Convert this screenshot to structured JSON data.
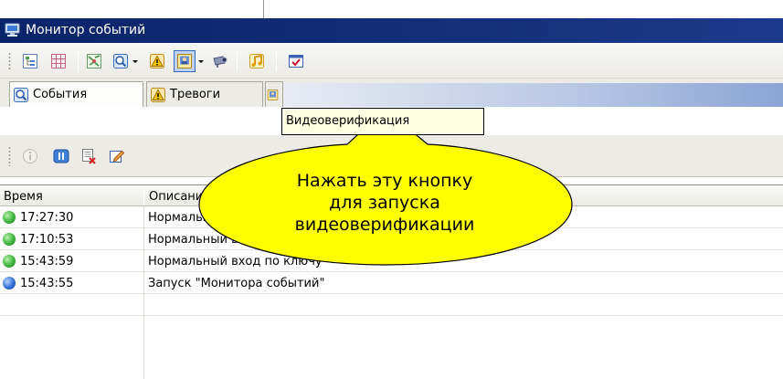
{
  "window": {
    "title": "Монитор событий",
    "title_icon": "monitor-icon"
  },
  "toolbar": {
    "buttons": [
      {
        "icon": "tree-view-icon"
      },
      {
        "icon": "grid-view-icon"
      },
      {
        "icon": "map-view-icon"
      },
      {
        "icon": "events-icon"
      },
      {
        "icon": "alarm-icon"
      },
      {
        "icon": "video-verification-icon",
        "pressed": true
      },
      {
        "icon": "camera-icon"
      },
      {
        "icon": "music-note-icon"
      },
      {
        "icon": "checked-window-icon"
      }
    ]
  },
  "tabs": [
    {
      "label": "События",
      "icon": "events-icon"
    },
    {
      "label": "Тревоги",
      "icon": "alarm-icon"
    },
    {
      "label": "",
      "icon": "video-verification-icon"
    }
  ],
  "tooltip": {
    "text": "Видеоверификация"
  },
  "callout": {
    "lines": [
      "Нажать эту кнопку",
      "для запуска",
      "видеоверификации"
    ]
  },
  "toolbar2": {
    "buttons": [
      {
        "icon": "info-icon"
      },
      {
        "icon": "pause-icon"
      },
      {
        "icon": "delete-list-icon"
      },
      {
        "icon": "edit-icon"
      }
    ]
  },
  "table": {
    "columns": [
      "Время",
      "Описание"
    ],
    "rows": [
      {
        "time": "17:27:30",
        "desc": "Нормальный вход по ключу",
        "status": "green"
      },
      {
        "time": "17:10:53",
        "desc": "Нормальный вход по ключу",
        "status": "green"
      },
      {
        "time": "15:43:59",
        "desc": "Нормальный вход по ключу",
        "status": "green"
      },
      {
        "time": "15:43:55",
        "desc": "Запуск \"Монитора событий\"",
        "status": "blue"
      }
    ]
  },
  "colors": {
    "titlebar": "#0a246a",
    "status_green": "#3cb43c",
    "status_blue": "#2f6fd6",
    "callout_fill": "#ffff00"
  }
}
